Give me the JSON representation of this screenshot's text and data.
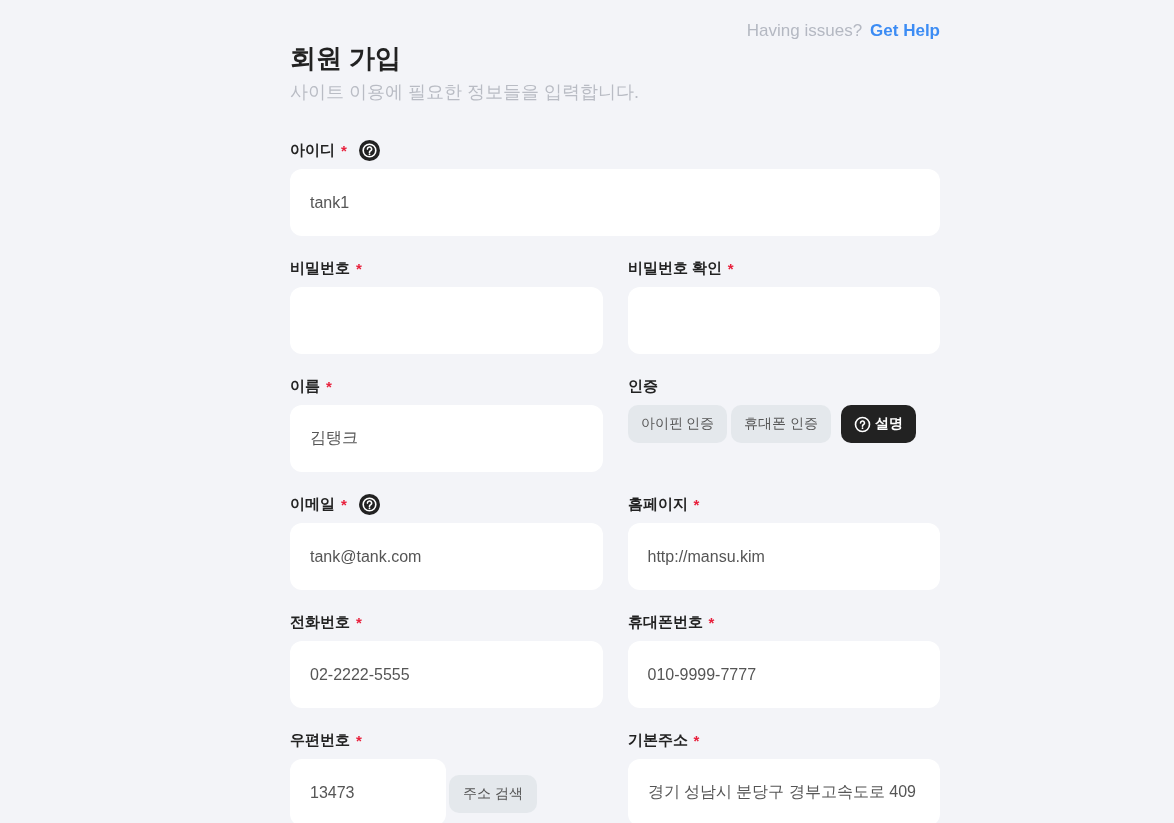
{
  "help_prompt": {
    "text": "Having issues?",
    "link": "Get Help"
  },
  "title": "회원 가입",
  "subtitle": "사이트 이용에 필요한 정보들을 입력합니다.",
  "fields": [
    {
      "kind": "input",
      "wide": true,
      "label": "아이디",
      "mark": "*",
      "help": true,
      "value": "tank1"
    },
    {
      "kind": "input",
      "wide": false,
      "label": "비밀번호",
      "mark": "*",
      "help": false
    },
    {
      "kind": "input",
      "wide": false,
      "label": "비밀번호 확인",
      "mark": "*",
      "help": false
    },
    {
      "kind": "input",
      "wide": false,
      "label": "이름",
      "mark": "*",
      "help": false,
      "value": "김탱크"
    },
    {
      "kind": "auth",
      "wide": false,
      "label": "인증",
      "help": false,
      "buttons": [
        "아이핀 인증",
        "휴대폰 인증"
      ],
      "explain": "설명"
    },
    {
      "kind": "input",
      "wide": false,
      "label": "이메일",
      "mark": "*",
      "help": true,
      "value": "tank@tank.com"
    },
    {
      "kind": "input",
      "wide": false,
      "label": "홈페이지",
      "mark": "*",
      "help": false,
      "value": "http://mansu.kim"
    },
    {
      "kind": "input",
      "wide": false,
      "label": "전화번호",
      "mark": "*",
      "help": false,
      "value": "02-2222-5555"
    },
    {
      "kind": "input",
      "wide": false,
      "label": "휴대폰번호",
      "mark": "*",
      "help": false,
      "value": "010-9999-7777"
    },
    {
      "kind": "zip",
      "wide": false,
      "label": "우편번호",
      "mark": "*",
      "help": false,
      "value": "13473",
      "button": "주소 검색"
    },
    {
      "kind": "input",
      "wide": false,
      "label": "기본주소",
      "mark": "*",
      "help": false,
      "value": "경기 성남시 분당구 경부고속도로 409"
    }
  ]
}
